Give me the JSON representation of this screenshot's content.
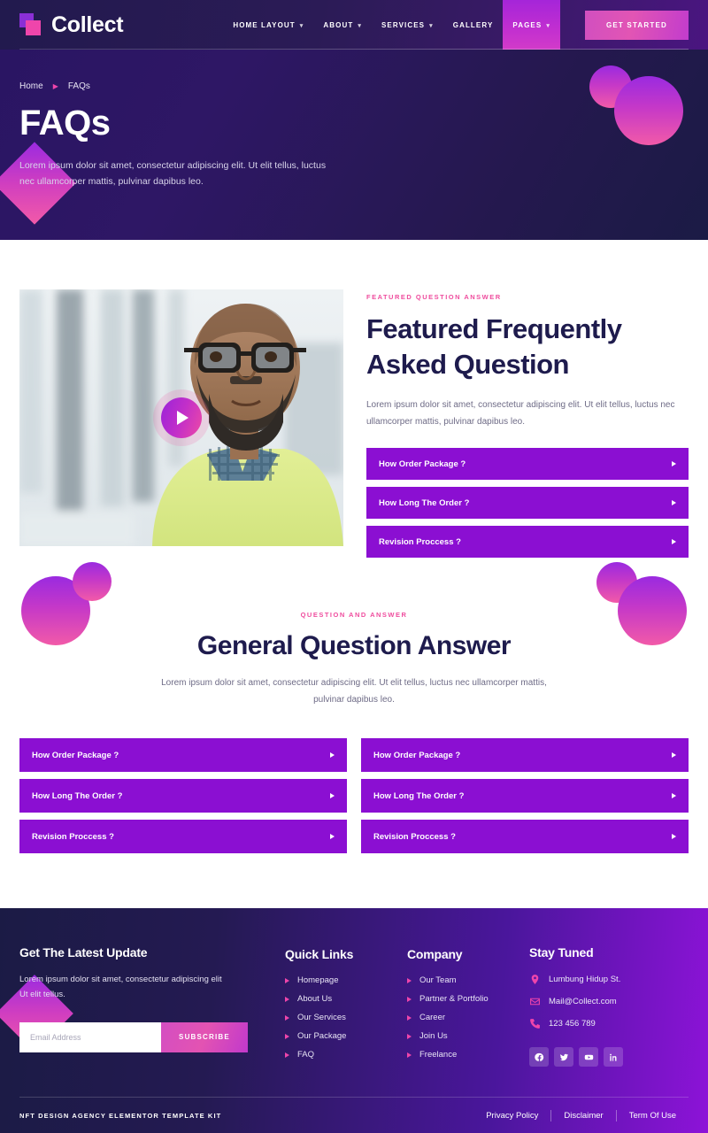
{
  "header": {
    "logo_text": "Collect",
    "nav": [
      {
        "label": "Home Layout",
        "has_caret": true,
        "active": false
      },
      {
        "label": "About",
        "has_caret": true,
        "active": false
      },
      {
        "label": "Services",
        "has_caret": true,
        "active": false
      },
      {
        "label": "Gallery",
        "has_caret": false,
        "active": false
      },
      {
        "label": "Pages",
        "has_caret": true,
        "active": true
      }
    ],
    "cta_label": "Get Started"
  },
  "hero": {
    "breadcrumb_home": "Home",
    "breadcrumb_current": "FAQs",
    "title": "FAQs",
    "description": "Lorem ipsum dolor sit amet, consectetur adipiscing elit. Ut elit tellus, luctus nec ullamcorper mattis, pulvinar dapibus leo."
  },
  "featured": {
    "eyebrow": "Featured Question Answer",
    "title": "Featured Frequently Asked Question",
    "description": "Lorem ipsum dolor sit amet, consectetur adipiscing elit. Ut elit tellus, luctus nec ullamcorper mattis, pulvinar dapibus leo.",
    "accordion": [
      {
        "label": "How Order Package ?"
      },
      {
        "label": "How Long The Order ?"
      },
      {
        "label": "Revision Proccess ?"
      }
    ]
  },
  "general": {
    "eyebrow": "Question And Answer",
    "title": "General Question Answer",
    "description": "Lorem ipsum dolor sit amet, consectetur adipiscing elit. Ut elit tellus, luctus nec ullamcorper mattis, pulvinar dapibus leo.",
    "left_column": [
      {
        "label": "How Order Package ?"
      },
      {
        "label": "How Long The Order ?"
      },
      {
        "label": "Revision Proccess ?"
      }
    ],
    "right_column": [
      {
        "label": "How Order Package ?"
      },
      {
        "label": "How Long The Order ?"
      },
      {
        "label": "Revision Proccess ?"
      }
    ]
  },
  "footer": {
    "newsletter": {
      "title": "Get The Latest Update",
      "description": "Lorem ipsum dolor sit amet, consectetur adipiscing elit Ut elit tellus.",
      "input_placeholder": "Email Address",
      "input_value": "",
      "button_label": "Subscribe"
    },
    "quick_links": {
      "title": "Quick Links",
      "items": [
        {
          "label": "Homepage"
        },
        {
          "label": "About Us"
        },
        {
          "label": "Our Services"
        },
        {
          "label": "Our Package"
        },
        {
          "label": "FAQ"
        }
      ]
    },
    "company": {
      "title": "Company",
      "items": [
        {
          "label": "Our Team"
        },
        {
          "label": "Partner & Portfolio"
        },
        {
          "label": "Career"
        },
        {
          "label": "Join Us"
        },
        {
          "label": "Freelance"
        }
      ]
    },
    "stay_tuned": {
      "title": "Stay Tuned",
      "contacts": [
        {
          "icon": "location-pin-icon",
          "text": "Lumbung Hidup St."
        },
        {
          "icon": "envelope-icon",
          "text": "Mail@Collect.com"
        },
        {
          "icon": "phone-icon",
          "text": "123 456 789"
        }
      ],
      "socials": [
        {
          "icon": "facebook-icon"
        },
        {
          "icon": "twitter-icon"
        },
        {
          "icon": "youtube-icon"
        },
        {
          "icon": "linkedin-icon"
        }
      ]
    },
    "bottom": {
      "copyright": "NFT Design Agency Elementor Template Kit",
      "links": [
        {
          "label": "Privacy Policy"
        },
        {
          "label": "Disclaimer"
        },
        {
          "label": "Term Of Use"
        }
      ]
    }
  },
  "colors": {
    "accent_pink": "#ef45ab",
    "accent_purple": "#8b0fd2",
    "dark_navy": "#1b1b45",
    "heading": "#1e1b4d"
  }
}
